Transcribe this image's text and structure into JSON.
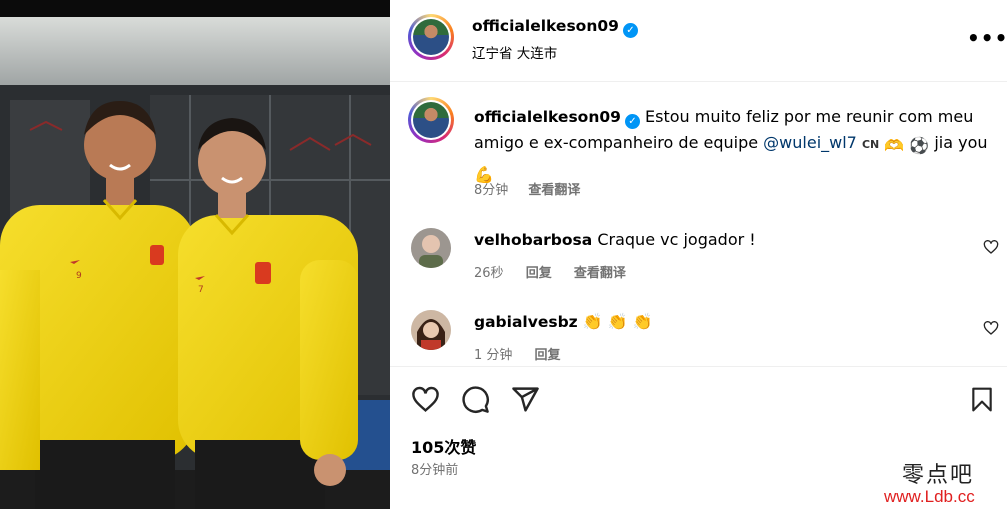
{
  "post_header": {
    "username": "officialelkeson09",
    "location": "辽宁省 大连市",
    "more_icon": "more-horizontal-icon"
  },
  "caption": {
    "username": "officialelkeson09",
    "text_part1": "Estou muito feliz por me reunir com meu amigo e ex-companheiro de equipe ",
    "mention": "@wulei_wl7",
    "flag": "CN",
    "emoji_hands": "🫶",
    "emoji_ball": "⚽",
    "text_part2": " jia you",
    "emoji_muscle": "💪",
    "time": "8分钟",
    "translate": "查看翻译"
  },
  "comments": [
    {
      "username": "velhobarbosa",
      "text": "Craque vc jogador !",
      "time": "26秒",
      "reply": "回复",
      "translate": "查看翻译"
    },
    {
      "username": "gabialvesbz",
      "text": "👏 👏 👏",
      "time": "1 分钟",
      "reply": "回复"
    }
  ],
  "actions": {
    "like_icon": "heart-icon",
    "comment_icon": "comment-icon",
    "share_icon": "send-icon",
    "save_icon": "bookmark-icon"
  },
  "likes": "105次赞",
  "posted": "8分钟前",
  "watermark": {
    "line1": "零点吧",
    "line2": "www.Ldb.cc"
  },
  "photo": {
    "jersey_numbers": [
      "9",
      "7"
    ]
  },
  "colors": {
    "verified": "#0095f6",
    "mention": "#00376b",
    "jersey": "#f2d21b",
    "watermark_red": "#e02020"
  }
}
